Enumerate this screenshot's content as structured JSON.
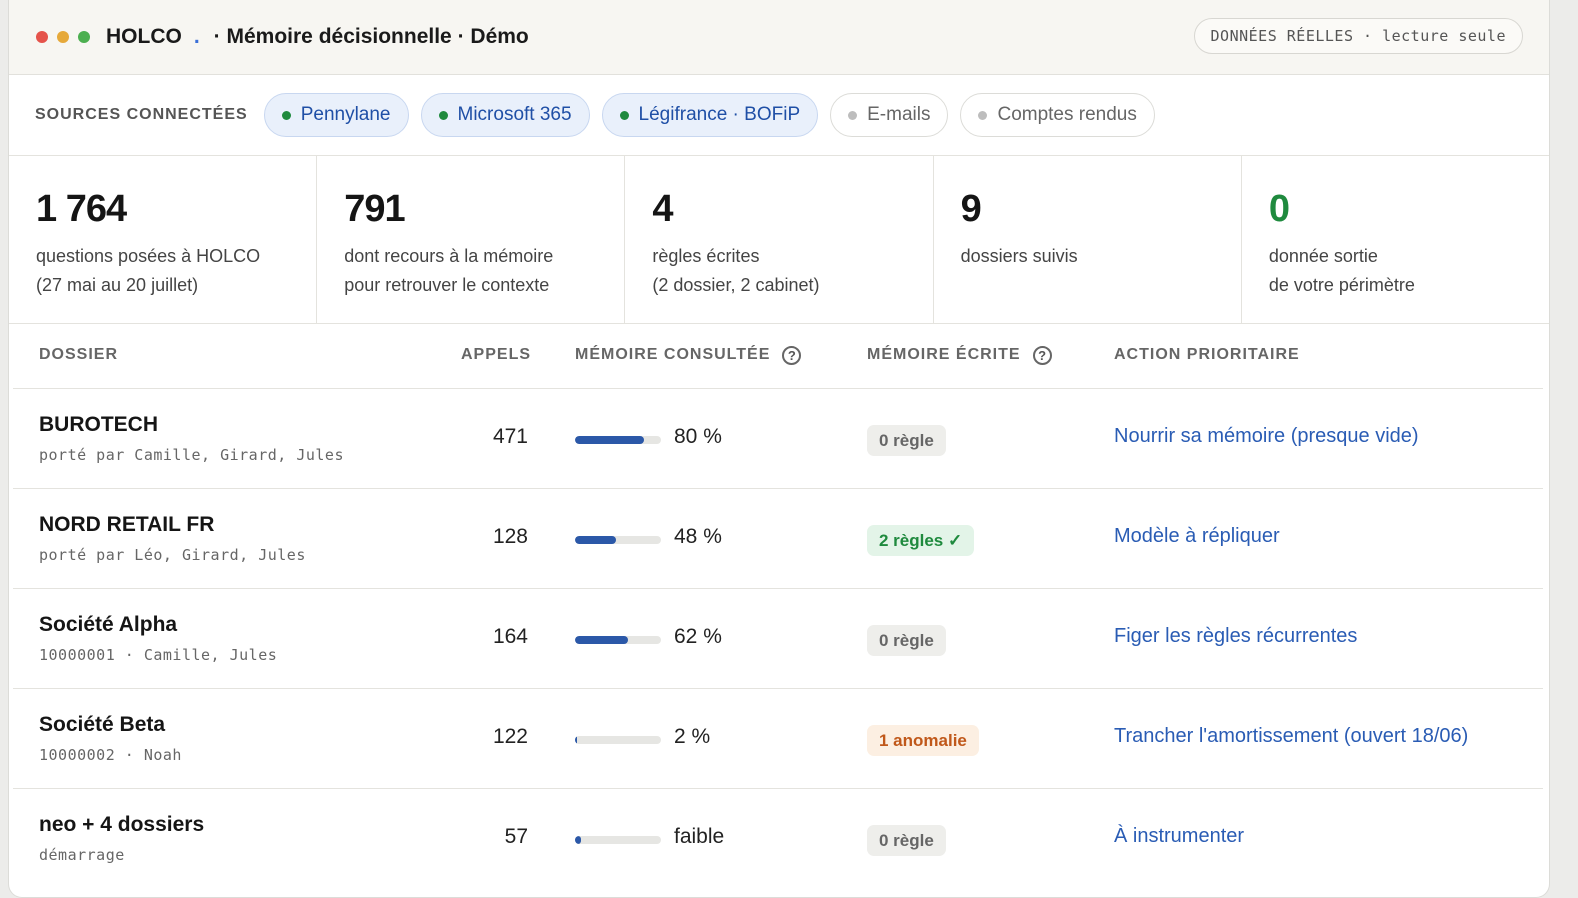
{
  "window": {
    "brand": "HOLCO",
    "separator": ".",
    "subtitle": "· Mémoire décisionnelle · Démo",
    "badge": "DONNÉES RÉELLES · lecture seule",
    "dot_colors": [
      "#e5534b",
      "#e6a93a",
      "#4caf50"
    ]
  },
  "sources": {
    "label": "SOURCES CONNECTÉES",
    "items": [
      {
        "label": "Pennylane",
        "status": "connected"
      },
      {
        "label": "Microsoft 365",
        "status": "connected"
      },
      {
        "label": "Légifrance · BOFiP",
        "status": "connected"
      },
      {
        "label": "E-mails",
        "status": "disconnected"
      },
      {
        "label": "Comptes rendus",
        "status": "disconnected"
      }
    ],
    "colors": {
      "connected": "#1f8a3e",
      "disconnected": "#bdbdbd"
    }
  },
  "stats": [
    {
      "value": "1 764",
      "line1": "questions posées à HOLCO",
      "line2": "(27 mai au 20 juillet)"
    },
    {
      "value": "791",
      "line1": "dont recours à la mémoire",
      "line2": "pour retrouver le contexte"
    },
    {
      "value": "4",
      "line1": "règles écrites",
      "line2": "(2 dossier, 2 cabinet)"
    },
    {
      "value": "9",
      "line1": "dossiers suivis",
      "line2": ""
    },
    {
      "value": "0",
      "line1": "donnée sortie",
      "line2": "de votre périmètre",
      "accent": "#1f8a3e"
    }
  ],
  "table": {
    "headers": {
      "dossier": "DOSSIER",
      "appels": "APPELS",
      "memoire_consultee": "MÉMOIRE CONSULTÉE",
      "memoire_ecrite": "MÉMOIRE ÉCRITE",
      "action": "ACTION PRIORITAIRE",
      "help_glyph": "?"
    },
    "rows": [
      {
        "name": "BUROTECH",
        "sub": "porté par Camille, Girard, Jules",
        "calls": "471",
        "memory_pct": 0.8,
        "memory_label": "80 %",
        "tag": "0 règle",
        "tag_kind": "gray",
        "action": "Nourrir sa mémoire (presque vide)"
      },
      {
        "name": "NORD RETAIL FR",
        "sub": "porté par Léo, Girard, Jules",
        "calls": "128",
        "memory_pct": 0.48,
        "memory_label": "48 %",
        "tag": "2 règles ✓",
        "tag_kind": "green",
        "action": "Modèle à répliquer"
      },
      {
        "name": "Société Alpha",
        "sub": "10000001 · Camille, Jules",
        "calls": "164",
        "memory_pct": 0.62,
        "memory_label": "62 %",
        "tag": "0 règle",
        "tag_kind": "gray",
        "action": "Figer les règles récurrentes"
      },
      {
        "name": "Société Beta",
        "sub": "10000002 · Noah",
        "calls": "122",
        "memory_pct": 0.02,
        "memory_label": "2 %",
        "tag": "1 anomalie",
        "tag_kind": "orange",
        "action": "Trancher l'amortissement (ouvert 18/06)"
      },
      {
        "name": "neo + 4 dossiers",
        "sub": "démarrage",
        "calls": "57",
        "memory_pct": 0.07,
        "memory_label": "faible",
        "tag": "0 règle",
        "tag_kind": "gray",
        "action": "À instrumenter"
      }
    ]
  }
}
